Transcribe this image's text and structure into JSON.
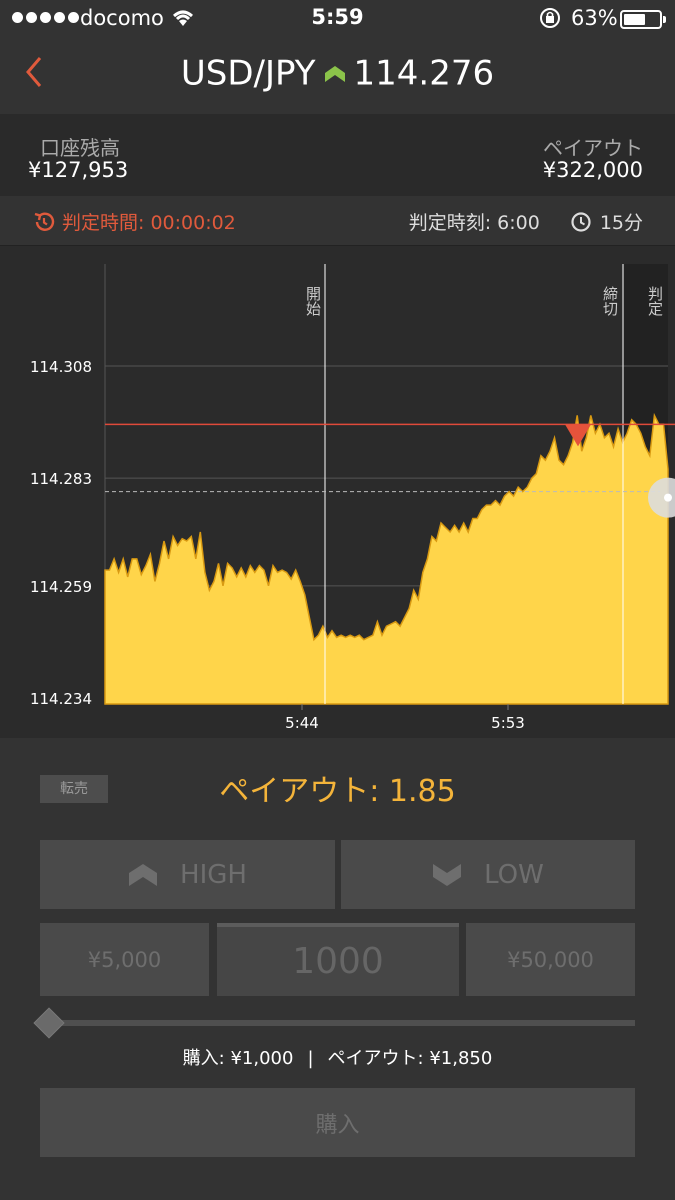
{
  "status_bar": {
    "carrier": "docomo",
    "time": "5:59",
    "battery_pct": "63%",
    "battery_level": 0.63
  },
  "header": {
    "pair": "USD/JPY",
    "price": "114.276",
    "trend_color": "#8bc34a"
  },
  "account": {
    "balance_label": "口座残高",
    "balance_value": "¥127,953",
    "payout_label": "ペイアウト",
    "payout_value": "¥322,000"
  },
  "timer": {
    "remaining_label": "判定時間: 00:00:02",
    "judge_time_label": "判定時刻: 6:00",
    "duration": "15分"
  },
  "chart_data": {
    "type": "area",
    "y_ticks": [
      "114.308",
      "114.283",
      "114.259",
      "114.234"
    ],
    "ylim": [
      114.234,
      114.308
    ],
    "x_ticks": [
      "5:44",
      "5:53"
    ],
    "markers": {
      "start": "開始",
      "close": "締切",
      "judge": "判定"
    },
    "entry_rate": 114.295,
    "current_rate": 114.28,
    "series_values": [
      114.2625,
      114.2625,
      114.265,
      114.262,
      114.265,
      114.261,
      114.265,
      114.265,
      114.2615,
      114.2635,
      114.266,
      114.26,
      114.264,
      114.269,
      114.265,
      114.27,
      114.268,
      114.2695,
      114.269,
      114.27,
      114.265,
      114.271,
      114.262,
      114.258,
      114.26,
      114.264,
      114.259,
      114.264,
      114.263,
      114.261,
      114.263,
      114.261,
      114.2635,
      114.262,
      114.2635,
      114.2625,
      114.259,
      114.2635,
      114.262,
      114.2625,
      114.262,
      114.2605,
      114.2625,
      114.26,
      114.257,
      114.252,
      114.247,
      114.248,
      114.25,
      114.2475,
      114.249,
      114.2475,
      114.248,
      114.2475,
      114.248,
      114.2475,
      114.248,
      114.247,
      114.2475,
      114.248,
      114.251,
      114.248,
      114.25,
      114.2505,
      114.251,
      114.25,
      114.252,
      114.254,
      114.258,
      114.256,
      114.262,
      114.265,
      114.27,
      114.269,
      114.273,
      114.272,
      114.271,
      114.2725,
      114.271,
      114.273,
      114.271,
      114.274,
      114.274,
      114.276,
      114.277,
      114.277,
      114.278,
      114.277,
      114.279,
      114.28,
      114.279,
      114.281,
      114.28,
      114.281,
      114.283,
      114.284,
      114.288,
      114.287,
      114.289,
      114.292,
      114.287,
      114.286,
      114.288,
      114.291,
      114.297,
      114.289,
      114.292,
      114.297,
      114.293,
      114.295,
      114.292,
      114.293,
      114.29,
      114.294,
      114.291,
      114.293,
      114.296,
      114.295,
      114.293,
      114.29,
      114.288,
      114.297,
      114.295,
      114.295,
      114.285
    ]
  },
  "trade": {
    "resell_label": "転売",
    "payout_rate": "ペイアウト: 1.85",
    "high_label": "HIGH",
    "low_label": "LOW",
    "amount_low": "¥5,000",
    "amount_value": "1000",
    "amount_high": "¥50,000",
    "summary_purchase": "購入: ¥1,000",
    "summary_payout": "ペイアウト: ¥1,850",
    "buy_label": "購入"
  }
}
